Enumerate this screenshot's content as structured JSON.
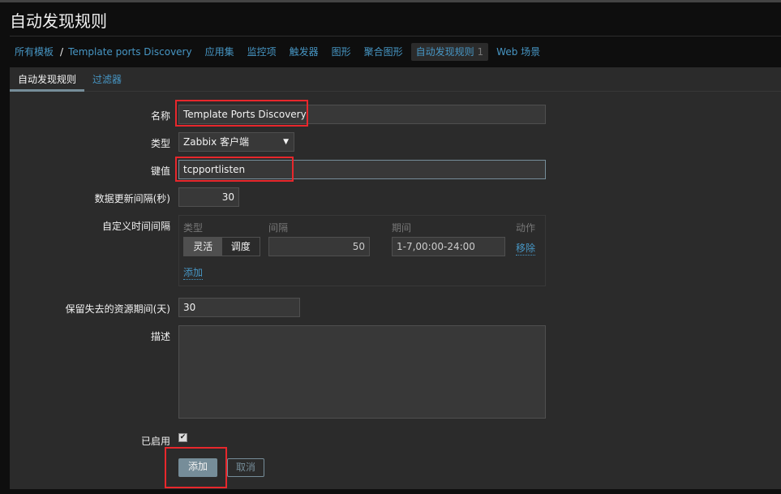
{
  "title": "自动发现规则",
  "breadcrumb": {
    "all": "所有模板",
    "sep": "/",
    "template": "Template ports Discovery"
  },
  "nav": [
    "应用集",
    "监控项",
    "触发器",
    "图形",
    "聚合图形"
  ],
  "nav_active": {
    "label": "自动发现规则",
    "count": "1"
  },
  "nav_web": "Web 场景",
  "tabs": [
    "自动发现规则",
    "过滤器"
  ],
  "form": {
    "name_label": "名称",
    "name_value": "Template Ports Discovery",
    "type_label": "类型",
    "type_value": "Zabbix 客户端",
    "key_label": "键值",
    "key_value": "tcpportlisten",
    "interval_label": "数据更新间隔(秒)",
    "interval_value": "30",
    "custom_label": "自定义时间间隔",
    "custom": {
      "col_type": "类型",
      "col_interval": "间隔",
      "col_period": "期间",
      "col_action": "动作",
      "flexible": "灵活",
      "scheduling": "调度",
      "interval": "50",
      "period": "1-7,00:00-24:00",
      "remove": "移除",
      "add": "添加"
    },
    "keep_label": "保留失去的资源期间(天)",
    "keep_value": "30",
    "desc_label": "描述",
    "desc_value": "",
    "enabled_label": "已启用",
    "enabled": true,
    "add_button": "添加",
    "cancel_button": "取消"
  },
  "colors": {
    "link": "#4796c4",
    "highlight": "#e8272c",
    "button": "#768d99"
  }
}
